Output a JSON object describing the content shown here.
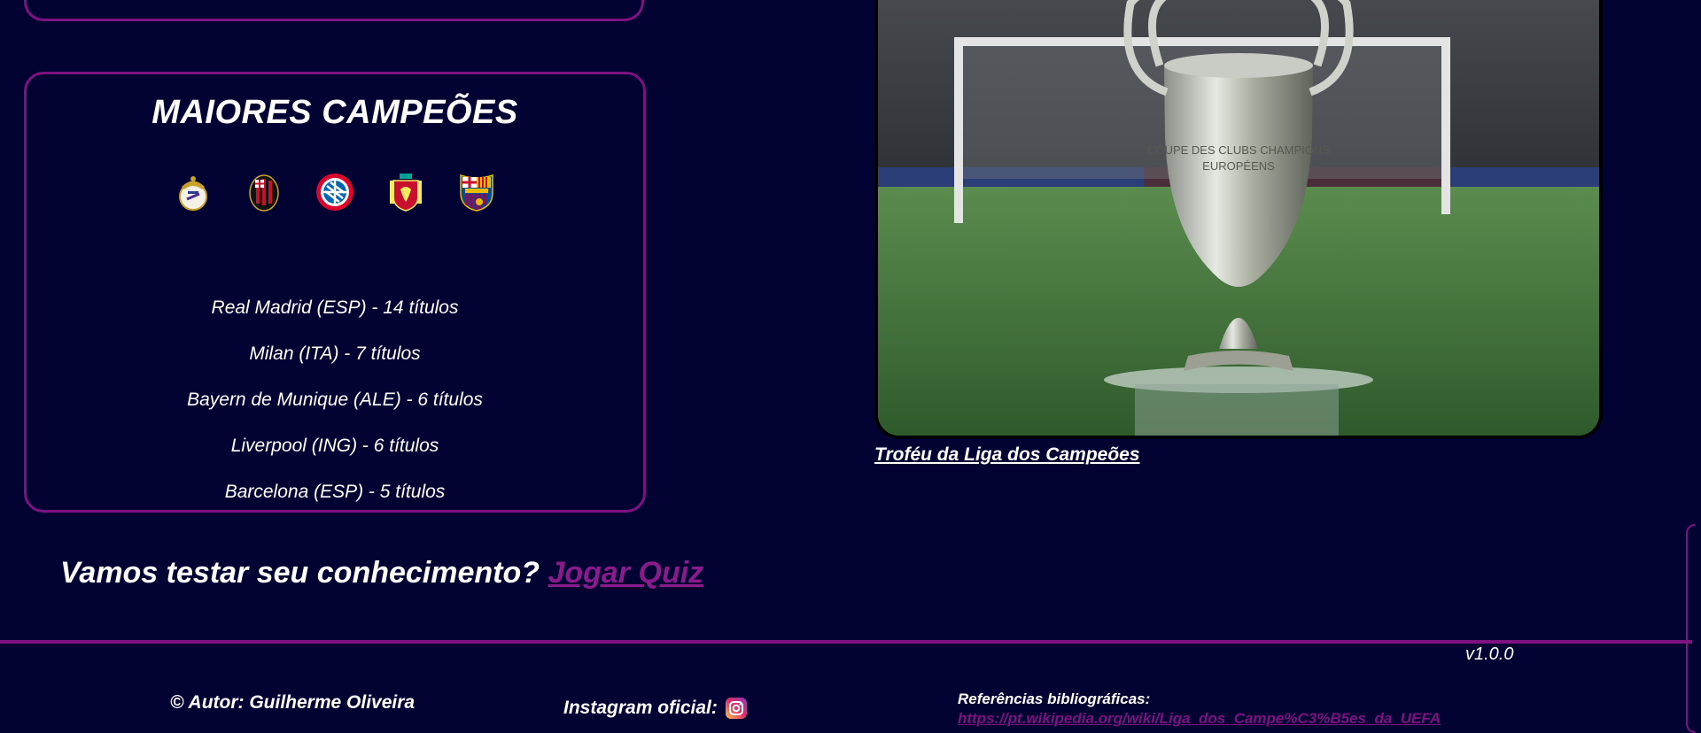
{
  "champions": {
    "title": "MAIORES CAMPEÕES",
    "clubs": [
      {
        "icon": "real-madrid-crest-icon",
        "text": "Real Madrid (ESP) - 14 títulos"
      },
      {
        "icon": "milan-crest-icon",
        "text": "Milan (ITA) - 7 títulos"
      },
      {
        "icon": "bayern-crest-icon",
        "text": "Bayern de Munique (ALE) - 6 títulos"
      },
      {
        "icon": "liverpool-crest-icon",
        "text": "Liverpool (ING) - 6 títulos"
      },
      {
        "icon": "barcelona-crest-icon",
        "text": "Barcelona (ESP) - 5 títulos"
      }
    ]
  },
  "trophy": {
    "caption": "Troféu da Liga dos Campeões"
  },
  "quiz": {
    "prompt": "Vamos testar seu conhecimento?",
    "link_label": "Jogar Quiz"
  },
  "footer": {
    "version": "v1.0.0",
    "author": "© Autor: Guilherme Oliveira",
    "instagram_label": "Instagram oficial:",
    "references_label": "Referências bibliográficas:",
    "references_link": "https://pt.wikipedia.org/wiki/Liga_dos_Campe%C3%B5es_da_UEFA"
  },
  "colors": {
    "background": "#020233",
    "accent": "#7d1280",
    "link": "#8a1b8c"
  }
}
